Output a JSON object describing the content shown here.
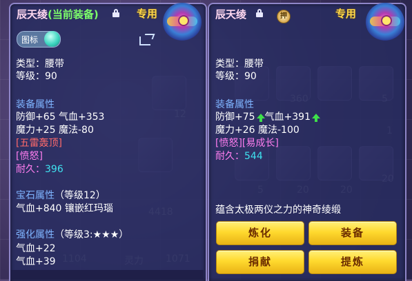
{
  "background": {
    "tile_counts": [
      "360",
      "5",
      "12",
      "20",
      "20",
      "20",
      "5",
      "1"
    ],
    "faint_texts": [
      "4418",
      "1104",
      "灵力",
      "1071"
    ]
  },
  "left_panel": {
    "item_name": "辰天绫",
    "equipped_tag": "(当前装备)",
    "exclusive_label": "专用",
    "icon_toggle_label": "图标",
    "type_line": "类型：腰带",
    "level_line": "等级：90",
    "equip_attr_header": "装备属性",
    "stats": [
      "防御+65 气血+353",
      "魔力+25 魔法-80"
    ],
    "special_skill": "[五雷轰顶]",
    "special_effect": "[愤怒]",
    "durability_label": "耐久：",
    "durability_value": "396",
    "gem_header": "宝石属性",
    "gem_level": "（等级12）",
    "gem_detail": "气血+840 镶嵌红玛瑙",
    "strengthen_header": "强化属性",
    "strengthen_level": "（等级3:★★★）",
    "strengthen_stats": [
      "气血+22",
      "气血+39"
    ]
  },
  "right_panel": {
    "item_name": "辰天绫",
    "exclusive_label": "专用",
    "pawn_icon_text": "押",
    "type_line": "类型：腰带",
    "level_line": "等级：90",
    "equip_attr_header": "装备属性",
    "stat_def": "防御+75",
    "stat_hp": "气血+391",
    "stat_line2": "魔力+26 魔法-100",
    "effects": "[愤怒][易成长]",
    "durability_label": "耐久：",
    "durability_value": "544",
    "description": "蕴含太极两仪之力的神奇绫缎",
    "buttons": {
      "refine": "炼化",
      "equip": "装备",
      "donate": "捐献",
      "extract": "提炼"
    }
  },
  "colors": {
    "panel_bg": "#282c60",
    "header_blue": "#7fb4ff",
    "durability_cyan": "#3fe3f0",
    "skill_red": "#ff6a6a",
    "effect_pink": "#ff7ef0",
    "button_yellow": "#ffd92e",
    "equipped_green": "#7dff6a"
  }
}
